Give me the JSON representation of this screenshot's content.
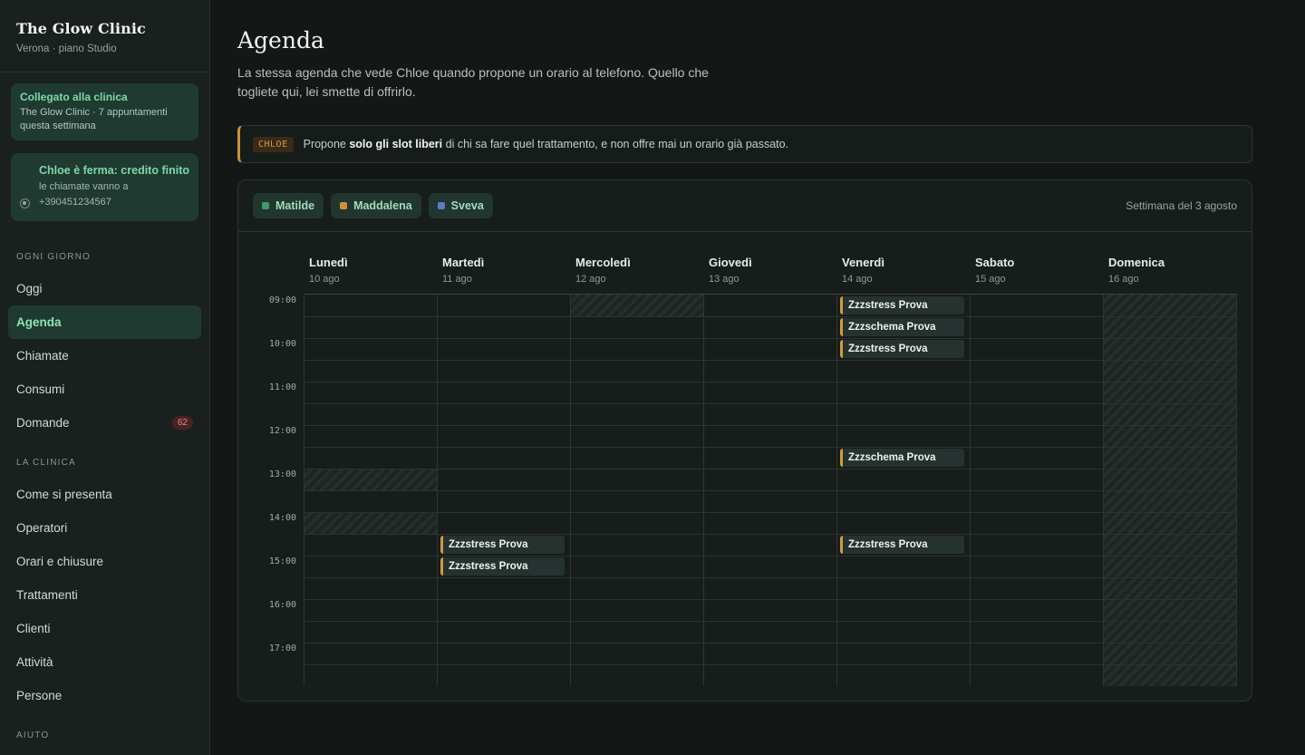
{
  "sidebar": {
    "brand_title": "The Glow Clinic",
    "brand_sub": "Verona · piano Studio",
    "connected": {
      "title": "Collegato alla clinica",
      "body": "The Glow Clinic · 7 appuntamenti questa settimana"
    },
    "stopped": {
      "title": "Chloe è ferma: credito finito",
      "body": "le chiamate vanno a +390451234567"
    },
    "sections": [
      {
        "label": "OGNI GIORNO",
        "items": [
          {
            "label": "Oggi",
            "active": false
          },
          {
            "label": "Agenda",
            "active": true
          },
          {
            "label": "Chiamate",
            "active": false
          },
          {
            "label": "Consumi",
            "active": false
          },
          {
            "label": "Domande",
            "active": false,
            "badge": "62"
          }
        ]
      },
      {
        "label": "LA CLINICA",
        "items": [
          {
            "label": "Come si presenta",
            "active": false
          },
          {
            "label": "Operatori",
            "active": false
          },
          {
            "label": "Orari e chiusure",
            "active": false
          },
          {
            "label": "Trattamenti",
            "active": false
          },
          {
            "label": "Clienti",
            "active": false
          },
          {
            "label": "Attività",
            "active": false
          },
          {
            "label": "Persone",
            "active": false
          }
        ]
      },
      {
        "label": "AIUTO",
        "items": []
      }
    ]
  },
  "page": {
    "title": "Agenda",
    "description": "La stessa agenda che vede Chloe quando propone un orario al telefono. Quello che togliete qui, lei smette di offrirlo."
  },
  "notice": {
    "tag": "CHLOE",
    "text_before": "Propone ",
    "text_bold": "solo gli slot liberi",
    "text_after": " di chi sa fare quel trattamento, e non offre mai un orario già passato."
  },
  "agenda": {
    "operators": [
      {
        "name": "Matilde",
        "color": "#3f9a6e"
      },
      {
        "name": "Maddalena",
        "color": "#c9933a"
      },
      {
        "name": "Sveva",
        "color": "#5b7bc4"
      }
    ],
    "week_label": "Settimana del 3 agosto",
    "days": [
      {
        "name": "Lunedì",
        "date": "10 ago"
      },
      {
        "name": "Martedì",
        "date": "11 ago"
      },
      {
        "name": "Mercoledì",
        "date": "12 ago"
      },
      {
        "name": "Giovedì",
        "date": "13 ago"
      },
      {
        "name": "Venerdì",
        "date": "14 ago"
      },
      {
        "name": "Sabato",
        "date": "15 ago"
      },
      {
        "name": "Domenica",
        "date": "16 ago"
      }
    ],
    "hours": [
      "09:00",
      "10:00",
      "11:00",
      "12:00",
      "13:00",
      "14:00",
      "15:00",
      "16:00",
      "17:00"
    ],
    "blocked": [
      {
        "day": 2,
        "slot": 0
      },
      {
        "day": 0,
        "slot": 8
      },
      {
        "day": 0,
        "slot": 10
      },
      {
        "day": 6,
        "slot": "all"
      }
    ],
    "events": [
      {
        "day": 4,
        "slot": 0,
        "label": "Zzzstress Prova"
      },
      {
        "day": 4,
        "slot": 1,
        "label": "Zzzschema Prova"
      },
      {
        "day": 4,
        "slot": 2,
        "label": "Zzzstress Prova"
      },
      {
        "day": 4,
        "slot": 7,
        "label": "Zzzschema Prova"
      },
      {
        "day": 1,
        "slot": 11,
        "label": "Zzzstress Prova"
      },
      {
        "day": 1,
        "slot": 12,
        "label": "Zzzstress Prova"
      },
      {
        "day": 4,
        "slot": 11,
        "label": "Zzzstress Prova"
      }
    ]
  }
}
